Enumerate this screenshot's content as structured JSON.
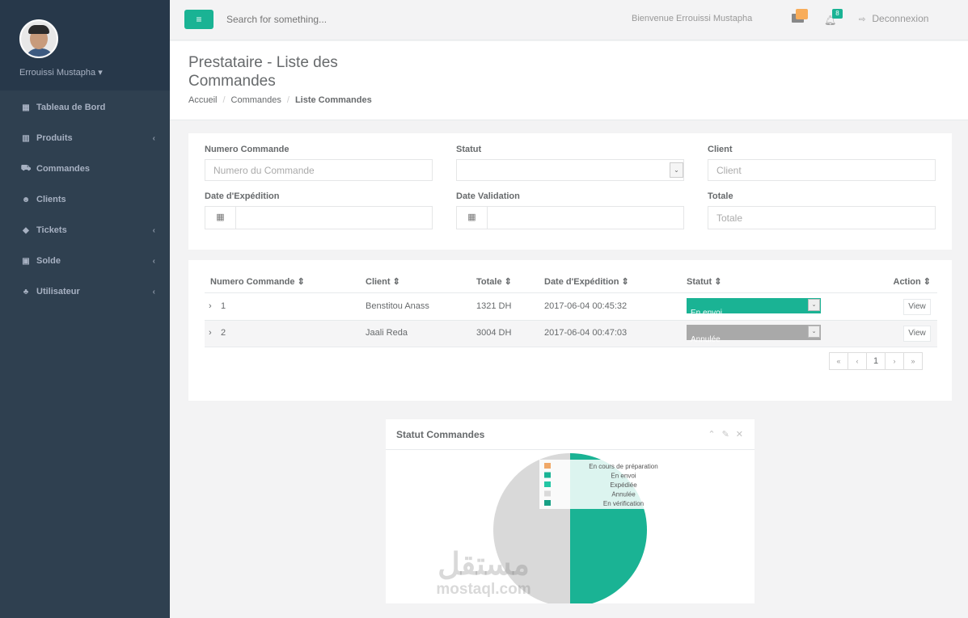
{
  "sidebar": {
    "user_name": "Errouissi Mustapha",
    "user_caret": "▾",
    "items": [
      {
        "icon": "dashboard-icon",
        "glyph": "▦",
        "label": "Tableau de Bord",
        "chevron": ""
      },
      {
        "icon": "products-icon",
        "glyph": "▥",
        "label": "Produits",
        "chevron": "‹"
      },
      {
        "icon": "cart-icon",
        "glyph": "⛟",
        "label": "Commandes",
        "chevron": ""
      },
      {
        "icon": "users-icon",
        "glyph": "☻",
        "label": "Clients",
        "chevron": ""
      },
      {
        "icon": "tag-icon",
        "glyph": "◆",
        "label": "Tickets",
        "chevron": "‹"
      },
      {
        "icon": "money-icon",
        "glyph": "▣",
        "label": "Solde",
        "chevron": "‹"
      },
      {
        "icon": "sitemap-icon",
        "glyph": "♣",
        "label": "Utilisateur",
        "chevron": "‹"
      }
    ]
  },
  "topbar": {
    "menu_glyph": "≡",
    "search_placeholder": "Search for something...",
    "welcome": "Bienvenue Errouissi Mustapha",
    "bell_count": "8",
    "logout_label": "Deconnexion",
    "logout_glyph": "⇨"
  },
  "heading": {
    "title": "Prestataire - Liste des Commandes",
    "breadcrumb": [
      "Accueil",
      "Commandes",
      "Liste Commandes"
    ]
  },
  "filters": {
    "numero_label": "Numero Commande",
    "numero_placeholder": "Numero du Commande",
    "statut_label": "Statut",
    "client_label": "Client",
    "client_placeholder": "Client",
    "date_exp_label": "Date d'Expédition",
    "date_val_label": "Date Validation",
    "totale_label": "Totale",
    "totale_placeholder": "Totale",
    "calendar_glyph": "▦",
    "caret_glyph": "⌄"
  },
  "table": {
    "headers": [
      "Numero Commande ⇕",
      "Client ⇕",
      "Totale ⇕",
      "Date d'Expédition ⇕",
      "Statut ⇕",
      "Action ⇕"
    ],
    "rows": [
      {
        "expand": "›",
        "num": "1",
        "client": "Benstitou Anass",
        "totale": "1321 DH",
        "date": "2017-06-04 00:45:32",
        "statut": "En envoi",
        "statut_color": "#1ab394",
        "action": "View"
      },
      {
        "expand": "›",
        "num": "2",
        "client": "Jaali Reda",
        "totale": "3004 DH",
        "date": "2017-06-04 00:47:03",
        "statut": "Annulée",
        "statut_color": "#a9a9a9",
        "action": "View"
      }
    ],
    "pager": [
      "«",
      "‹",
      "1",
      "›",
      "»"
    ]
  },
  "chart_panel": {
    "title": "Statut Commandes",
    "tools": [
      "⌃",
      "✎",
      "✕"
    ]
  },
  "chart_data": {
    "type": "pie",
    "title": "Statut Commandes",
    "legend_position": "top-right",
    "series": [
      {
        "name": "En cours de préparation",
        "value": 0,
        "color": "#f0a868"
      },
      {
        "name": "En envoi",
        "value": 1,
        "color": "#1ab394"
      },
      {
        "name": "Expédiée",
        "value": 0,
        "color": "#23c6a4"
      },
      {
        "name": "Annulée",
        "value": 1,
        "color": "#d9d9d9"
      },
      {
        "name": "En vérification",
        "value": 0,
        "color": "#17a085"
      }
    ]
  },
  "watermark": {
    "arabic": "مستقل",
    "latin": "mostaql.com"
  }
}
